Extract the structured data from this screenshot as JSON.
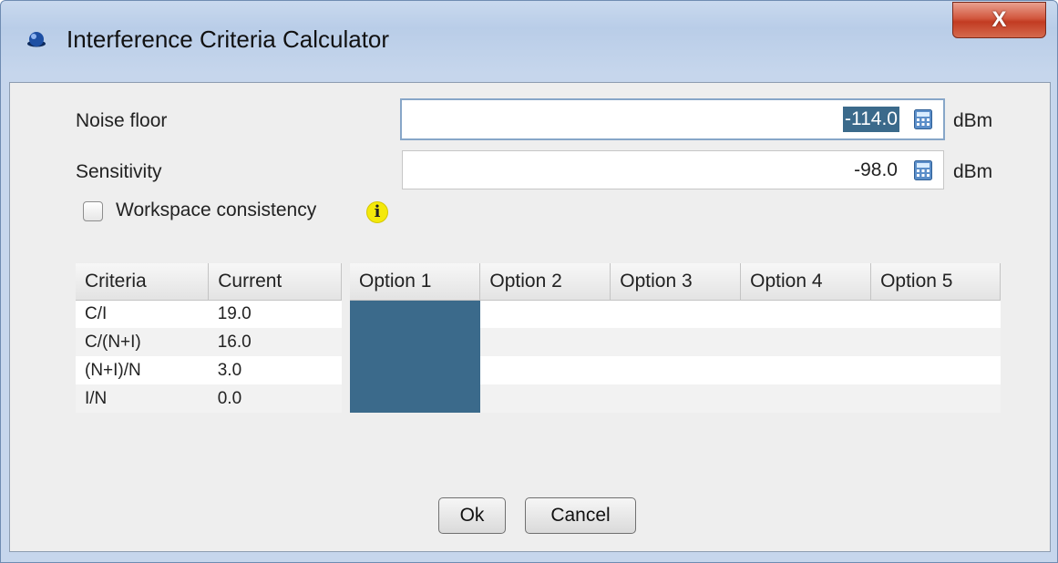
{
  "window": {
    "title": "Interference Criteria Calculator",
    "close_label": "X"
  },
  "form": {
    "noise_floor": {
      "label": "Noise floor",
      "value": "-114.0",
      "unit": "dBm"
    },
    "sensitivity": {
      "label": "Sensitivity",
      "value": "-98.0",
      "unit": "dBm"
    },
    "workspace_consistency": {
      "label": "Workspace consistency",
      "checked": false,
      "info_glyph": "i"
    }
  },
  "criteria_table": {
    "headers": [
      "Criteria",
      "Current"
    ],
    "rows": [
      [
        "C/I",
        "19.0"
      ],
      [
        "C/(N+I)",
        "16.0"
      ],
      [
        "(N+I)/N",
        "3.0"
      ],
      [
        "I/N",
        "0.0"
      ]
    ]
  },
  "options_table": {
    "headers": [
      "Option 1",
      "Option 2",
      "Option 3",
      "Option 4",
      "Option 5"
    ],
    "selected_column": 0
  },
  "buttons": {
    "ok": "Ok",
    "cancel": "Cancel"
  },
  "colors": {
    "selection": "#3b6a8b",
    "close_button": "#c23b22"
  },
  "icons": {
    "app": "app-globe-icon",
    "calculator": "calculator-icon",
    "info": "info-icon"
  }
}
